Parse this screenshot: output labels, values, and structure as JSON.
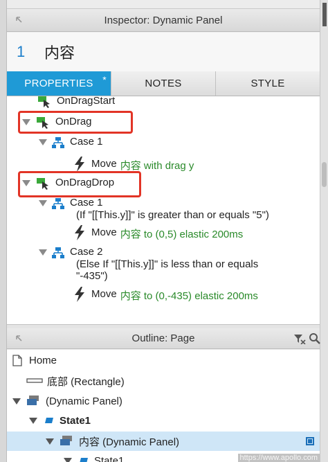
{
  "inspector": {
    "header_title": "Inspector: Dynamic Panel",
    "widget_number": "1",
    "widget_name": "内容",
    "tabs": [
      {
        "label": "PROPERTIES",
        "marker": "*"
      },
      {
        "label": "NOTES"
      },
      {
        "label": "STYLE"
      }
    ],
    "events": {
      "on_drag_start": "OnDragStart",
      "on_drag": "OnDrag",
      "drag_case1": "Case 1",
      "drag_action_verb": "Move",
      "drag_action_rest": "内容 with drag y",
      "on_drag_drop": "OnDragDrop",
      "drop_case1": "Case 1",
      "drop_case1_cond": "(If \"[[This.y]]\" is greater than or equals \"5\")",
      "drop_case1_verb": "Move",
      "drop_case1_rest": "内容 to (0,5) elastic 200ms",
      "drop_case2": "Case 2",
      "drop_case2_cond1": "(Else If \"[[This.y]]\" is less than or equals",
      "drop_case2_cond2": "\"-435\")",
      "drop_case2_verb": "Move",
      "drop_case2_rest": "内容 to (0,-435) elastic 200ms"
    }
  },
  "outline": {
    "header_title": "Outline: Page",
    "items": [
      {
        "label": "Home"
      },
      {
        "label": "底部 (Rectangle)"
      },
      {
        "label": "(Dynamic Panel)"
      },
      {
        "label": "State1"
      },
      {
        "label": "内容 (Dynamic Panel)"
      },
      {
        "label": "State1"
      }
    ]
  },
  "watermark": "https://www.apollo.com",
  "colors": {
    "accent": "#1f9ad6",
    "action_green": "#2a8a2a",
    "highlight_red": "#e23426",
    "title_blue": "#1b7ecb",
    "selected_row": "#cfe6f7"
  }
}
